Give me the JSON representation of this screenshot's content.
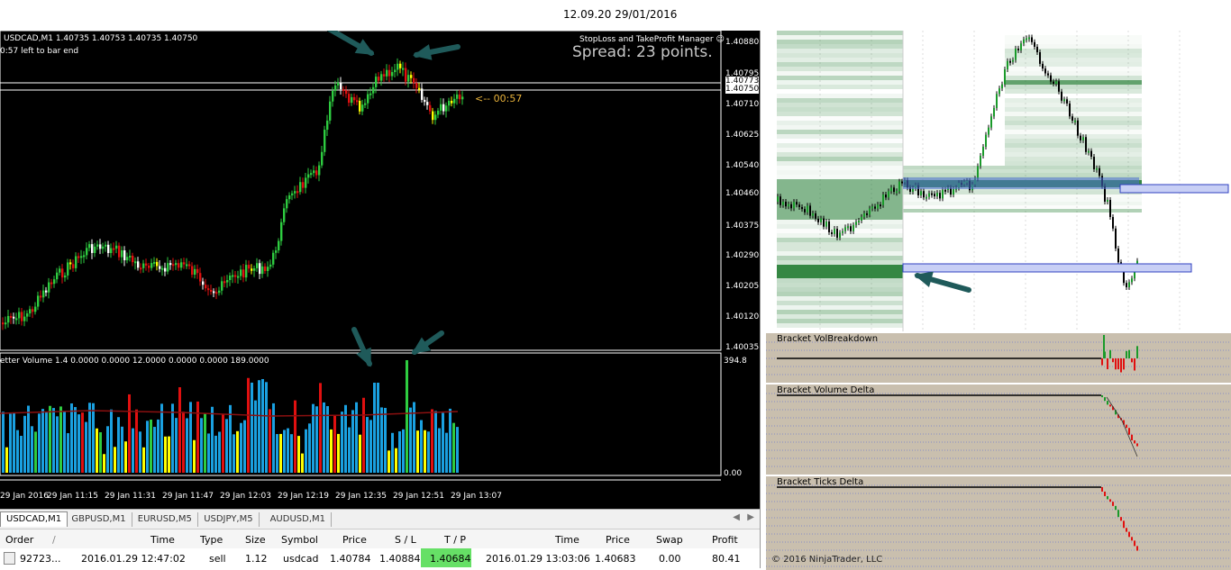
{
  "top_timestamp": "12.09.20 29/01/2016",
  "mt4": {
    "chart_title": "USDCAD,M1  1.40735 1.40753 1.40735 1.40750",
    "bar_end": "0:57 left to bar end",
    "sl_tp_manager": "StopLoss and TakeProfit Manager ☺",
    "spread": "Spread: 23 points.",
    "countdown": "<-- 00:57",
    "price_axis": [
      "1.40880",
      "1.40795",
      "1.40773",
      "1.40750",
      "1.40710",
      "1.40625",
      "1.40540",
      "1.40460",
      "1.40375",
      "1.40290",
      "1.40205",
      "1.40120",
      "1.40035"
    ],
    "volume_title": "etter Volume 1.4 0.0000 0.0000 12.0000 0.0000 0.0000 189.0000",
    "volume_max": "394.8",
    "volume_zero": "0.00",
    "time_axis": [
      "29 Jan 2016",
      "29 Jan 11:15",
      "29 Jan 11:31",
      "29 Jan 11:47",
      "29 Jan 12:03",
      "29 Jan 12:19",
      "29 Jan 12:35",
      "29 Jan 12:51",
      "29 Jan 13:07"
    ],
    "tabs": [
      "USDCAD,M1",
      "GBPUSD,M1",
      "EURUSD,M5",
      "USDJPY,M5",
      "AUDUSD,M1"
    ],
    "table_headers": [
      "Order",
      "/",
      "Time",
      "Type",
      "Size",
      "Symbol",
      "Price",
      "S / L",
      "T / P",
      "Time",
      "Price",
      "Swap",
      "Profit"
    ],
    "table_row": {
      "order": "92723...",
      "time": "2016.01.29 12:47:02",
      "type": "sell",
      "size": "1.12",
      "symbol": "usdcad",
      "price": "1.40784",
      "sl": "1.40884",
      "tp": "1.40684",
      "close_time": "2016.01.29 13:03:06",
      "close_price": "1.40683",
      "swap": "0.00",
      "profit": "80.41"
    }
  },
  "nt": {
    "panels": [
      "Bracket VolBreakdown",
      "Bracket Volume Delta",
      "Bracket Ticks Delta"
    ],
    "copyright": "© 2016 NinjaTrader, LLC"
  },
  "colors": {
    "bull": "#2ecc40",
    "bear": "#e01010",
    "neutral_up": "#ffff00",
    "vol_bar": "#1aa0e0",
    "tp_highlight": "#66e066",
    "arrow": "#1f5a5a",
    "nt_panel_bg": "#c9bfae",
    "value_area": "#4d6fd6"
  }
}
